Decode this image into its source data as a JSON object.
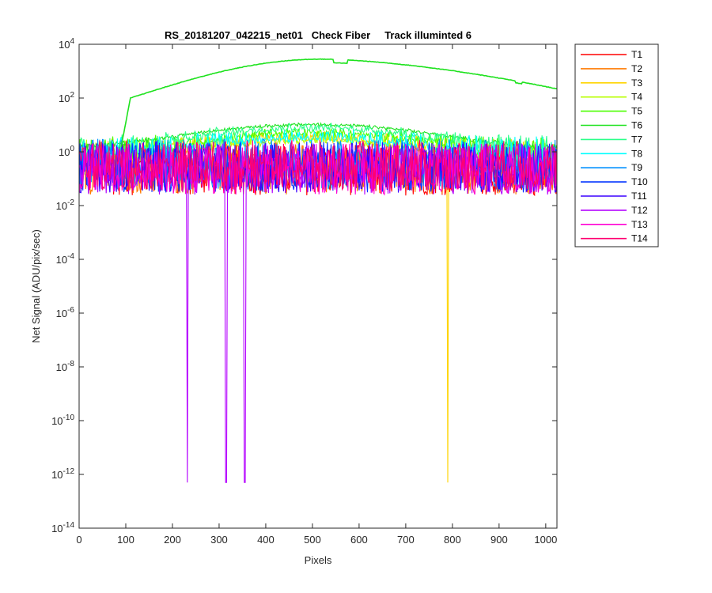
{
  "chart_data": {
    "type": "line",
    "title": "RS_20181207_042215_net01   Check Fiber     Track illuminted 6",
    "xlabel": "Pixels",
    "ylabel": "Net Signal (ADU/pix/sec)",
    "xlim": [
      0,
      1024
    ],
    "ylim_exponents": [
      -14,
      4
    ],
    "yscale": "log",
    "x_ticks": [
      0,
      100,
      200,
      300,
      400,
      500,
      600,
      700,
      800,
      900,
      1000
    ],
    "y_ticks": [
      {
        "base": "10",
        "exp": "4"
      },
      {
        "base": "10",
        "exp": "2"
      },
      {
        "base": "10",
        "exp": "0"
      },
      {
        "base": "10",
        "exp": "-2"
      },
      {
        "base": "10",
        "exp": "-4"
      },
      {
        "base": "10",
        "exp": "-6"
      },
      {
        "base": "10",
        "exp": "-8"
      },
      {
        "base": "10",
        "exp": "-10"
      },
      {
        "base": "10",
        "exp": "-12"
      },
      {
        "base": "10",
        "exp": "-14"
      }
    ],
    "grid": false,
    "legend_position": "outside-right",
    "series": [
      {
        "name": "T1",
        "color": "#ff0000",
        "level": 0.55
      },
      {
        "name": "T2",
        "color": "#ff7a00",
        "level": 0.6
      },
      {
        "name": "T3",
        "color": "#ffd400",
        "level": 0.9,
        "hump": 3,
        "dropouts": [
          {
            "x": 790,
            "value": 5e-13
          }
        ]
      },
      {
        "name": "T4",
        "color": "#b8ff00",
        "level": 0.9,
        "hump": 2.5
      },
      {
        "name": "T5",
        "color": "#4cff00",
        "level": 1.0,
        "hump": 5
      },
      {
        "name": "T6",
        "color": "#1ee21e",
        "level": 1.2,
        "hump": 9,
        "main_peak": {
          "start_x": 90,
          "rise_to": 110,
          "value_at_110": 100,
          "peak_x": 520,
          "peak_value": 2800,
          "end_value": 220
        }
      },
      {
        "name": "T7",
        "color": "#2bff8a",
        "level": 1.2,
        "hump": 8
      },
      {
        "name": "T8",
        "color": "#00ffff",
        "level": 1.1,
        "hump": 3
      },
      {
        "name": "T9",
        "color": "#0090ff",
        "level": 0.9
      },
      {
        "name": "T10",
        "color": "#0033ff",
        "level": 0.7
      },
      {
        "name": "T11",
        "color": "#3a00ff",
        "level": 0.7
      },
      {
        "name": "T12",
        "color": "#b400ff",
        "level": 0.6,
        "dropouts": [
          {
            "x": 232,
            "value": 5e-13
          },
          {
            "x": 315,
            "value": 5e-13
          },
          {
            "x": 355,
            "value": 5e-13
          }
        ]
      },
      {
        "name": "T13",
        "color": "#ff00d4",
        "level": 0.6
      },
      {
        "name": "T14",
        "color": "#ff0070",
        "level": 0.8
      }
    ]
  }
}
